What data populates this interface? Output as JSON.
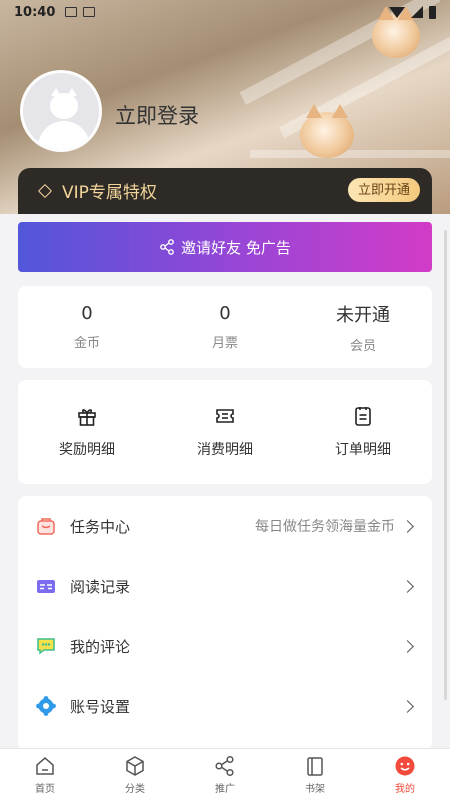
{
  "status_bar": {
    "time": "10:40"
  },
  "profile": {
    "login_text": "立即登录"
  },
  "vip": {
    "label": "VIP专属特权",
    "button": "立即开通"
  },
  "invite": {
    "label": "邀请好友 免广告"
  },
  "stats": [
    {
      "value": "0",
      "label": "金币"
    },
    {
      "value": "0",
      "label": "月票"
    },
    {
      "value": "未开通",
      "label": "会员"
    }
  ],
  "details": [
    {
      "icon": "gift-icon",
      "label": "奖励明细"
    },
    {
      "icon": "ticket-icon",
      "label": "消费明细"
    },
    {
      "icon": "order-list-icon",
      "label": "订单明细"
    }
  ],
  "menu": [
    {
      "icon": "task-bag-icon",
      "label": "任务中心",
      "hint": "每日做任务领海量金币",
      "color": "#f06a5a"
    },
    {
      "icon": "reading-record-icon",
      "label": "阅读记录",
      "hint": "",
      "color": "#7c6df0"
    },
    {
      "icon": "comment-icon",
      "label": "我的评论",
      "hint": "",
      "color": "#3bbf8e"
    },
    {
      "icon": "settings-gear-icon",
      "label": "账号设置",
      "hint": "",
      "color": "#2f9be8"
    }
  ],
  "tabs": [
    {
      "icon": "home-icon",
      "label": "首页",
      "active": false
    },
    {
      "icon": "category-cube-icon",
      "label": "分类",
      "active": false
    },
    {
      "icon": "share-icon",
      "label": "推广",
      "active": false
    },
    {
      "icon": "bookshelf-icon",
      "label": "书架",
      "active": false
    },
    {
      "icon": "smiley-icon",
      "label": "我的",
      "active": true
    }
  ],
  "colors": {
    "accent": "#f24a3c",
    "vip_gold": "#f2d59a",
    "invite_gradient_start": "#5256d9",
    "invite_gradient_end": "#d23cc7"
  }
}
